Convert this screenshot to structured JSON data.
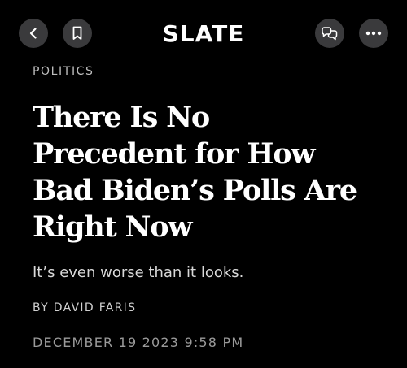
{
  "header": {
    "logo_text": "SLATE",
    "icons": {
      "back": "chevron-left-icon",
      "bookmark": "bookmark-icon",
      "share": "share-icon",
      "more": "more-dots-icon"
    }
  },
  "article": {
    "section": "POLITICS",
    "headline_lines": [
      "There Is No",
      "Precedent for How",
      "Bad Biden’s Polls Are",
      "Right Now"
    ],
    "dek": "It’s even worse than it looks.",
    "byline": "BY DAVID FARIS",
    "date": "DECEMBER 19 2023 9:58 PM"
  },
  "colors": {
    "background": "#000000",
    "button_bg": "#3a3a3c",
    "text_primary": "#ffffff",
    "text_muted": "#9a9a9a"
  }
}
